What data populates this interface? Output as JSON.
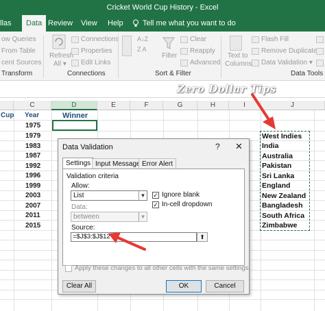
{
  "window": {
    "title": "Cricket World Cup History  -  Excel"
  },
  "tabs": [
    {
      "label": "llas",
      "active": false
    },
    {
      "label": "Data",
      "active": true
    },
    {
      "label": "Review",
      "active": false
    },
    {
      "label": "View",
      "active": false
    },
    {
      "label": "Help",
      "active": false
    }
  ],
  "tell_me": "Tell me what you want to do",
  "ribbon": {
    "transform": {
      "items": [
        "ow Queries",
        "From Table",
        "cent Sources"
      ],
      "group": "Transform"
    },
    "connections": {
      "refresh_line1": "Refresh",
      "refresh_line2": "All ▾",
      "items": [
        "Connections",
        "Properties",
        "Edit Links"
      ],
      "group": "Connections"
    },
    "sort_filter": {
      "filter": "Filter",
      "items": [
        "Clear",
        "Reapply",
        "Advanced"
      ],
      "group": "Sort & Filter"
    },
    "data_tools": {
      "text_cols_1": "Text to",
      "text_cols_2": "Columns",
      "items": [
        "Flash Fill",
        "Remove Duplicates",
        "Data Validation ▾"
      ],
      "group": "Data Tools"
    },
    "sort_glyph_az": "A↓Z",
    "sort_glyph_za": "Z A"
  },
  "watermark": "Zero Dollar Tips",
  "grid": {
    "columns": [
      "C",
      "D",
      "E",
      "F",
      "G",
      "H",
      "I",
      "J"
    ],
    "selected_column": "D",
    "header_cup": "Cup",
    "header_year": "Year",
    "header_winner": "Winner",
    "years": [
      "1975",
      "1979",
      "1983",
      "1987",
      "1992",
      "1996",
      "1999",
      "2003",
      "2007",
      "2011",
      "2015"
    ],
    "teams": [
      "West Indies",
      "India",
      "Australia",
      "Pakistan",
      "Sri Lanka",
      "England",
      "New Zealand",
      "Bangladesh",
      "South Africa",
      "Zimbabwe"
    ]
  },
  "dialog": {
    "title": "Data Validation",
    "help": "?",
    "close": "✕",
    "tabs": [
      "Settings",
      "Input Message",
      "Error Alert"
    ],
    "criteria_label": "Validation criteria",
    "allow_label": "Allow:",
    "allow_value": "List",
    "data_label": "Data:",
    "data_value": "between",
    "ignore_blank": "Ignore blank",
    "in_cell_dropdown": "In-cell dropdown",
    "source_label": "Source:",
    "source_value": "=$J$3:$J$12",
    "apply_all": "Apply these changes to all other cells with the same settings",
    "clear_all": "Clear All",
    "ok": "OK",
    "cancel": "Cancel"
  },
  "colors": {
    "excel_green": "#217346",
    "arrow_red": "#e53935",
    "header_blue": "#1f4e79"
  }
}
